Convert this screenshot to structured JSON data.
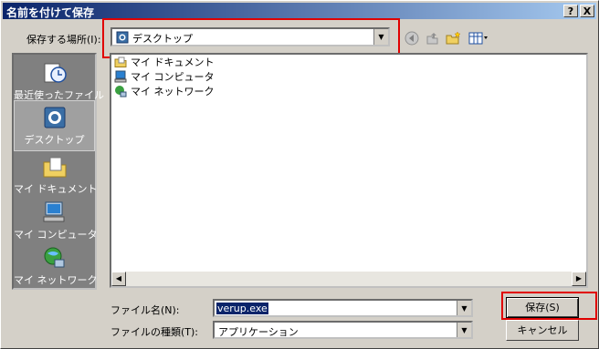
{
  "window": {
    "title": "名前を付けて保存",
    "help_button": "?",
    "close_button": "X"
  },
  "save_in": {
    "label": "保存する場所(I):",
    "value": "デスクトップ"
  },
  "places": [
    {
      "label": "最近使ったファイル",
      "icon": "recent-icon"
    },
    {
      "label": "デスクトップ",
      "icon": "desktop-icon",
      "selected": true
    },
    {
      "label": "マイ ドキュメント",
      "icon": "my-documents-icon"
    },
    {
      "label": "マイ コンピュータ",
      "icon": "my-computer-icon"
    },
    {
      "label": "マイ ネットワーク",
      "icon": "my-network-icon"
    }
  ],
  "files": [
    {
      "name": "マイ ドキュメント",
      "icon": "folder-icon"
    },
    {
      "name": "マイ コンピュータ",
      "icon": "computer-icon"
    },
    {
      "name": "マイ ネットワーク",
      "icon": "network-icon"
    }
  ],
  "filename": {
    "label": "ファイル名(N):",
    "value": "verup.exe"
  },
  "filetype": {
    "label": "ファイルの種類(T):",
    "value": "アプリケーション"
  },
  "buttons": {
    "save": "保存(S)",
    "cancel": "キャンセル"
  },
  "colors": {
    "highlight": "#e00000",
    "title_start": "#0a246a",
    "title_end": "#a6caf0"
  }
}
